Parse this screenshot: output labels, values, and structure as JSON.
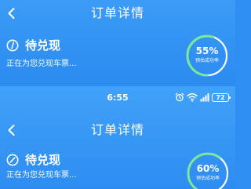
{
  "screens": [
    {
      "title": "订单详情",
      "status": {
        "title": "待兑现",
        "description": "正在为您兑现车票..."
      },
      "success_rate": {
        "value": "55%",
        "label": "预估成功率",
        "fraction": 0.55
      }
    },
    {
      "title": "订单详情",
      "status": {
        "title": "待兑现",
        "description": "正在为您兑现车票..."
      },
      "success_rate": {
        "value": "60%",
        "label": "预估成功率",
        "fraction": 0.6
      }
    }
  ],
  "status_bar": {
    "time": "6:55",
    "battery": "72",
    "icons": [
      "alarm-icon",
      "wifi-icon",
      "signal-icon",
      "battery-icon"
    ]
  },
  "colors": {
    "background": "#3b9bf6",
    "text": "#ffffff",
    "ring_track": "#ffffff",
    "ring_progress": "#7de89a"
  }
}
